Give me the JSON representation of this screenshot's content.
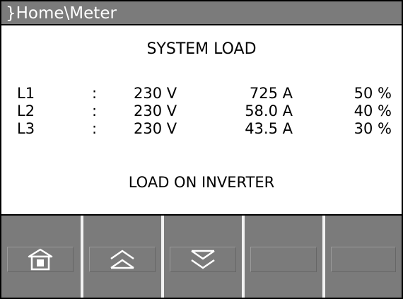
{
  "title_bar": {
    "path": "}Home\\Meter"
  },
  "screen": {
    "heading": "SYSTEM LOAD",
    "rows": [
      {
        "phase": "L1",
        "sep": ":",
        "voltage": "230 V",
        "current": "725 A",
        "load": "50 %"
      },
      {
        "phase": "L2",
        "sep": ":",
        "voltage": "230 V",
        "current": "58.0 A",
        "load": "40 %"
      },
      {
        "phase": "L3",
        "sep": ":",
        "voltage": "230 V",
        "current": "43.5 A",
        "load": "30 %"
      }
    ],
    "status": "LOAD ON INVERTER"
  },
  "softkeys": [
    {
      "icon": "home-icon"
    },
    {
      "icon": "page-up-icon"
    },
    {
      "icon": "page-down-icon"
    },
    {
      "icon": ""
    },
    {
      "icon": ""
    }
  ],
  "colors": {
    "title_bar_bg": "#7b7b7b",
    "softkey_bg": "#7b7b7b",
    "text": "#000000",
    "screen_bg": "#ffffff"
  }
}
